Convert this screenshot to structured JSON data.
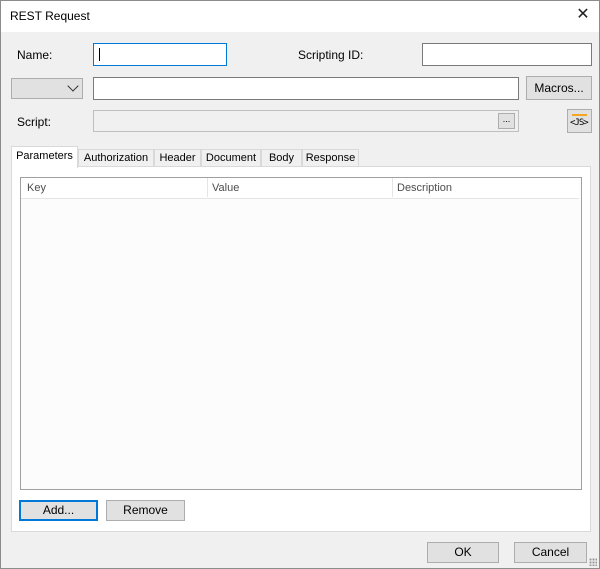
{
  "window": {
    "title": "REST Request",
    "close_glyph": "✕"
  },
  "form": {
    "name_label": "Name:",
    "name_value": "",
    "scripting_id_label": "Scripting ID:",
    "scripting_id_value": "",
    "method_value": "",
    "url_value": "",
    "macros_label": "Macros...",
    "script_label": "Script:",
    "script_value": "",
    "script_browse_label": "...",
    "js_button_text": "<JS>"
  },
  "tabs": [
    {
      "label": "Parameters",
      "active": true
    },
    {
      "label": "Authorization",
      "active": false
    },
    {
      "label": "Header",
      "active": false
    },
    {
      "label": "Document",
      "active": false
    },
    {
      "label": "Body",
      "active": false
    },
    {
      "label": "Response",
      "active": false
    }
  ],
  "grid": {
    "columns": [
      "Key",
      "Value",
      "Description"
    ],
    "rows": []
  },
  "panel_buttons": {
    "add_label": "Add...",
    "remove_label": "Remove"
  },
  "footer": {
    "ok_label": "OK",
    "cancel_label": "Cancel"
  },
  "colors": {
    "accent": "#0078d7",
    "js_icon": "#f5a623"
  }
}
